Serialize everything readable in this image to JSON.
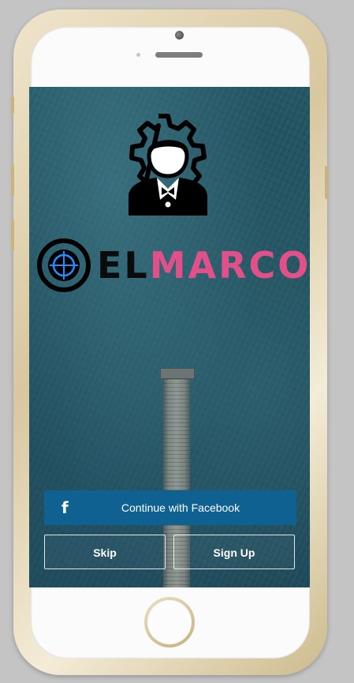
{
  "app": {
    "brand_part1": "EL",
    "brand_part2": "MARCO"
  },
  "buttons": {
    "facebook_label": "Continue with Facebook",
    "facebook_icon_glyph": "f",
    "skip_label": "Skip",
    "signup_label": "Sign Up"
  },
  "icons": [
    "gear-person-icon",
    "target-icon",
    "facebook-icon",
    "camera-icon",
    "speaker-icon",
    "home-button-icon"
  ],
  "colors": {
    "brand_dark": "#0b0b0b",
    "brand_pink": "#e2508a",
    "facebook_blue": "#0f6191",
    "target_blue": "#1e90ff",
    "ocean": "#1f4d5b"
  }
}
